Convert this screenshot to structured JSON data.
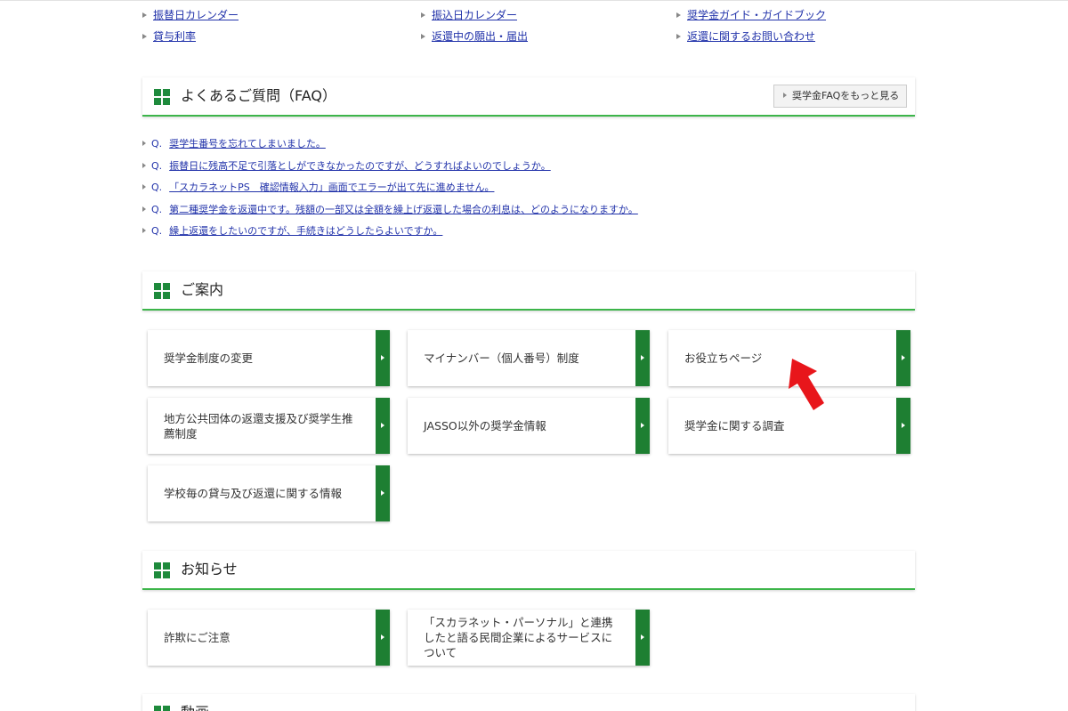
{
  "top_links": [
    {
      "label": "振替日カレンダー"
    },
    {
      "label": "振込日カレンダー"
    },
    {
      "label": "奨学金ガイド・ガイドブック"
    },
    {
      "label": "貸与利率"
    },
    {
      "label": "返還中の願出・届出"
    },
    {
      "label": "返還に関するお問い合わせ"
    }
  ],
  "faq": {
    "title": "よくあるご質問（FAQ）",
    "more_label": "奨学金FAQをもっと見る",
    "q_prefix": "Q.",
    "items": [
      {
        "text": "奨学生番号を忘れてしまいました。"
      },
      {
        "text": "振替日に残高不足で引落としができなかったのですが、どうすればよいのでしょうか。"
      },
      {
        "text": "「スカラネットPS　確認情報入力」画面でエラーが出て先に進めません。"
      },
      {
        "text": "第二種奨学金を返還中です。残額の一部又は全額を繰上げ返還した場合の利息は、どのようになりますか。"
      },
      {
        "text": "繰上返還をしたいのですが、手続きはどうしたらよいですか。"
      }
    ]
  },
  "guide": {
    "title": "ご案内",
    "cards": [
      {
        "label": "奨学金制度の変更"
      },
      {
        "label": "マイナンバー（個人番号）制度"
      },
      {
        "label": "お役立ちページ"
      },
      {
        "label": "地方公共団体の返還支援及び奨学生推薦制度"
      },
      {
        "label": "JASSO以外の奨学金情報"
      },
      {
        "label": "奨学金に関する調査"
      },
      {
        "label": "学校毎の貸与及び返還に関する情報"
      }
    ]
  },
  "news": {
    "title": "お知らせ",
    "cards": [
      {
        "label": "詐欺にご注意"
      },
      {
        "label": "「スカラネット・パーソナル」と連携したと語る民間企業によるサービスについて"
      }
    ]
  },
  "video": {
    "title": "動画"
  },
  "colors": {
    "accent_green": "#1e7f32",
    "header_underline": "#3cb54a",
    "link": "#2233aa",
    "annotation_red": "#e8161b"
  },
  "icons": {
    "section_icon": "green-squares-icon",
    "link_marker": "triangle-right-icon",
    "card_arrow": "chevron-right-icon",
    "annotation": "red-arrow-icon"
  }
}
